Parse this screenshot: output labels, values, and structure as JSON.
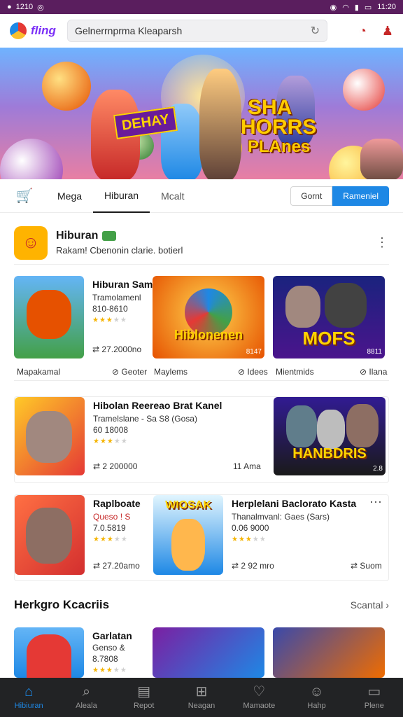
{
  "status": {
    "time_left": "1210",
    "time_right": "11:20"
  },
  "header": {
    "logo_text": "fling",
    "search_placeholder": "Gelnerrnprma Kleaparsh"
  },
  "banner": {
    "badge": "DEHAY",
    "title_line1": "SHA",
    "title_line2": "HORRS",
    "title_line3": "PLAnes"
  },
  "tabs": {
    "items": [
      "Mega",
      "Hiburan",
      "Mcalt"
    ],
    "active": "Hiburan",
    "seg_left": "Gornt",
    "seg_right": "Rameniel"
  },
  "app": {
    "name": "Hiburan",
    "desc": "Rakam! Cbenonin clarie. botierl"
  },
  "row1": {
    "title": "Hiburan Same",
    "line1": "Tramolamenl",
    "line2": "810-8610",
    "foot_left": "27.2000no",
    "thumb2_label": "Hiblonenen",
    "thumb2_corner": "8147",
    "thumb3_label": "MOFS",
    "thumb3_corner": "8811",
    "cap1": "Mapakamal",
    "cap1_right": "Geoter",
    "cap2": "Maylems",
    "cap2_right": "Idees",
    "cap3": "Mientmids",
    "cap3_right": "Ilana"
  },
  "row2": {
    "title": "Hibolan Reereao Brat Kanel",
    "line1": "Tramelslane - Sa S8 (Gosa)",
    "line2": "60 18008",
    "foot_left": "2 200000",
    "foot_right": "11 Ama",
    "thumb_label": "HANBDRIS",
    "thumb_corner": "2.8"
  },
  "row3": {
    "title1": "Raplboate",
    "line1a": "Queso ! S",
    "line1b": "7.0.5819",
    "foot1": "27.20amo",
    "thumb_label": "WIOSAK",
    "title2": "Herplelani Baclorato Kasta",
    "line2a": "Thanalmvanl: Gaes (Sars)",
    "line2b": "0.06 9000",
    "foot2": "2 92 mro",
    "foot2_right": "Suom"
  },
  "section": {
    "title": "Herkgro Kcacriis",
    "link": "Scantal"
  },
  "row4": {
    "title": "Garlatan",
    "line1": "Genso &",
    "line2": "8.7808"
  },
  "nav": [
    "Hibiuran",
    "Aleala",
    "Repot",
    "Neagan",
    "Mamaote",
    "Hahp",
    "Plene"
  ]
}
